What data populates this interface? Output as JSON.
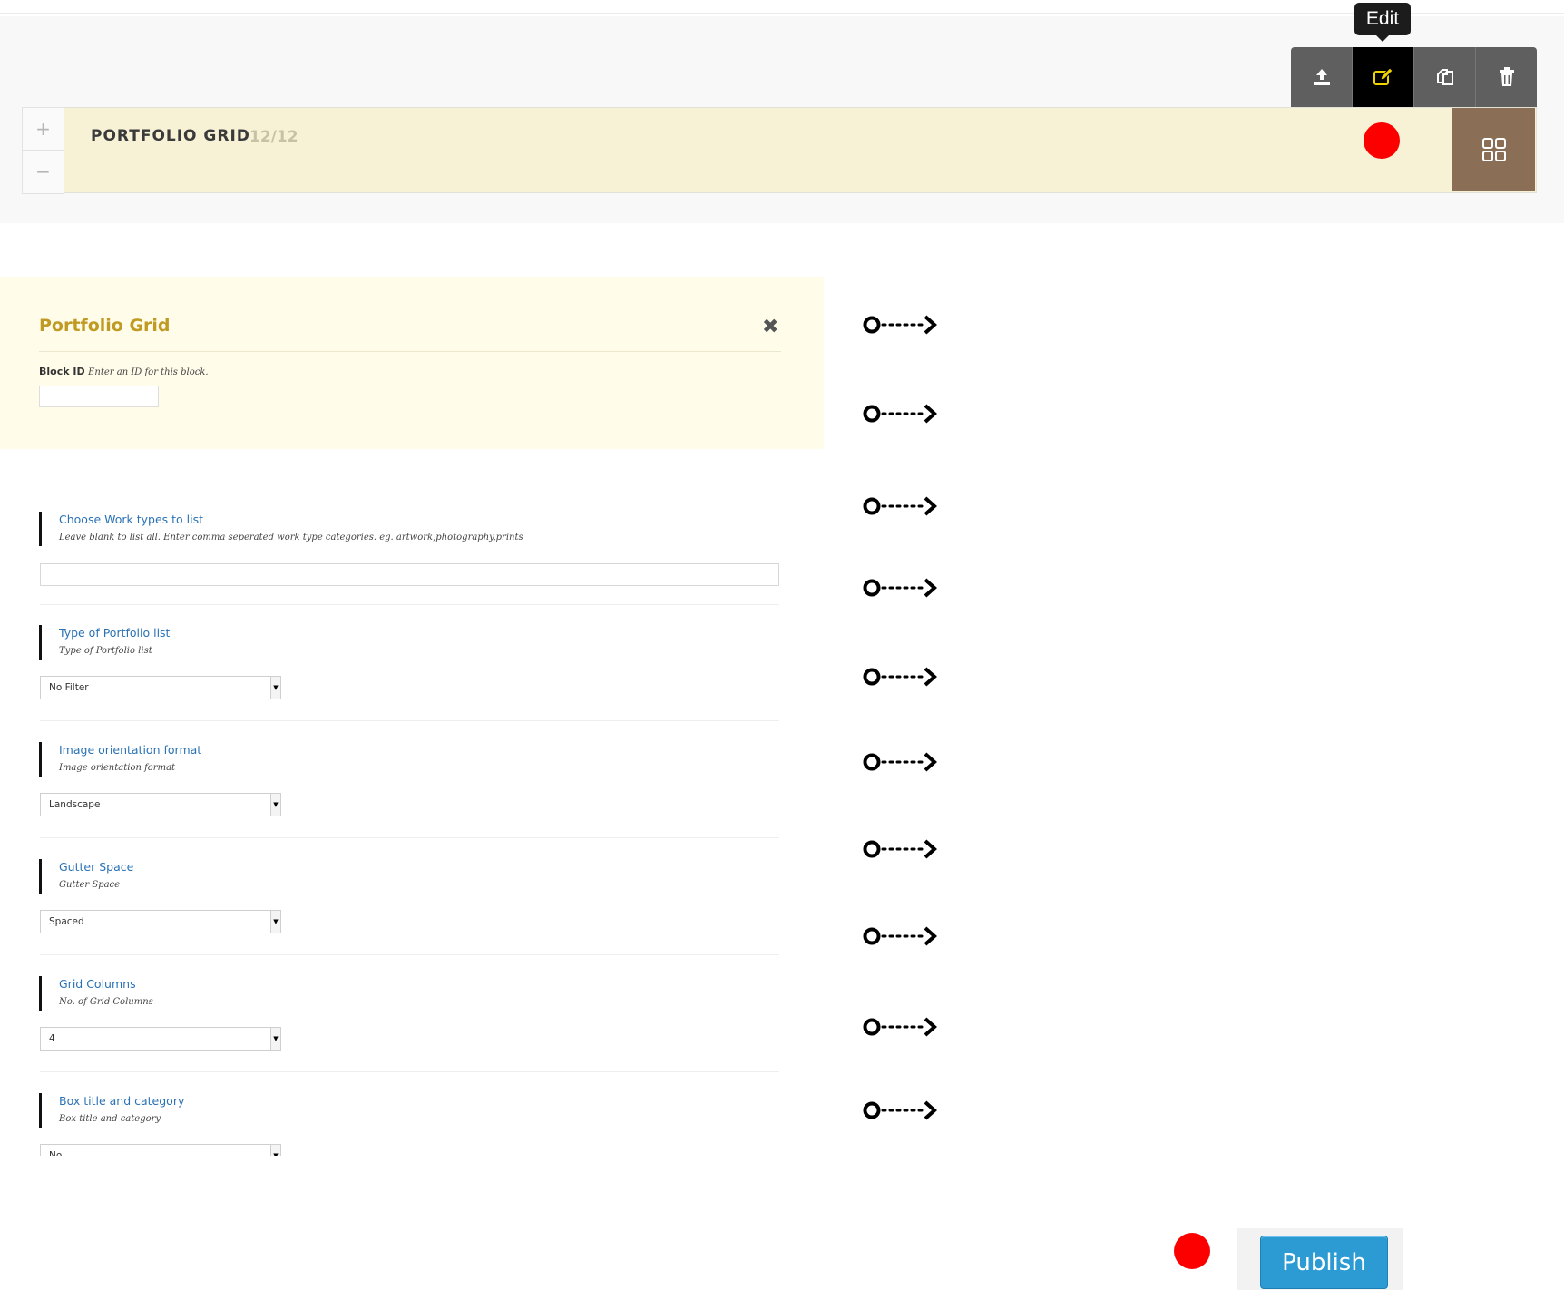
{
  "toolbar": {
    "tooltip": "Edit",
    "buttons": [
      {
        "name": "upload-icon"
      },
      {
        "name": "edit-icon",
        "active": true
      },
      {
        "name": "copy-icon"
      },
      {
        "name": "trash-icon"
      }
    ]
  },
  "block": {
    "plus": "+",
    "minus": "−",
    "title": "PORTFOLIO GRID",
    "size": "12/12",
    "grid_icon": "grid-icon"
  },
  "panel": {
    "title": "Portfolio Grid",
    "close": "✖",
    "block_id_label": "Block ID",
    "block_id_hint": "Enter an ID for this block.",
    "block_id_value": ""
  },
  "fields": [
    {
      "title": "Choose Work types to list",
      "desc": "Leave blank to list all. Enter comma seperated work type categories. eg. artwork,photography,prints",
      "type": "text",
      "value": ""
    },
    {
      "title": "Type of Portfolio list",
      "desc": "Type of Portfolio list",
      "type": "select",
      "value": "No Filter"
    },
    {
      "title": "Image orientation format",
      "desc": "Image orientation format",
      "type": "select",
      "value": "Landscape"
    },
    {
      "title": "Gutter Space",
      "desc": "Gutter Space",
      "type": "select",
      "value": "Spaced"
    },
    {
      "title": "Grid Columns",
      "desc": "No. of Grid Columns",
      "type": "select",
      "value": "4"
    },
    {
      "title": "Box title and category",
      "desc": "Box title and category",
      "type": "select",
      "value": "No"
    }
  ],
  "publish": {
    "label": "Publish"
  },
  "colors": {
    "accent_red": "#fc0000",
    "publish_blue": "#2d9bd3",
    "panel_bg": "#fffcea",
    "block_bg": "#f7f1d6",
    "grid_btn": "#8a6e55"
  }
}
